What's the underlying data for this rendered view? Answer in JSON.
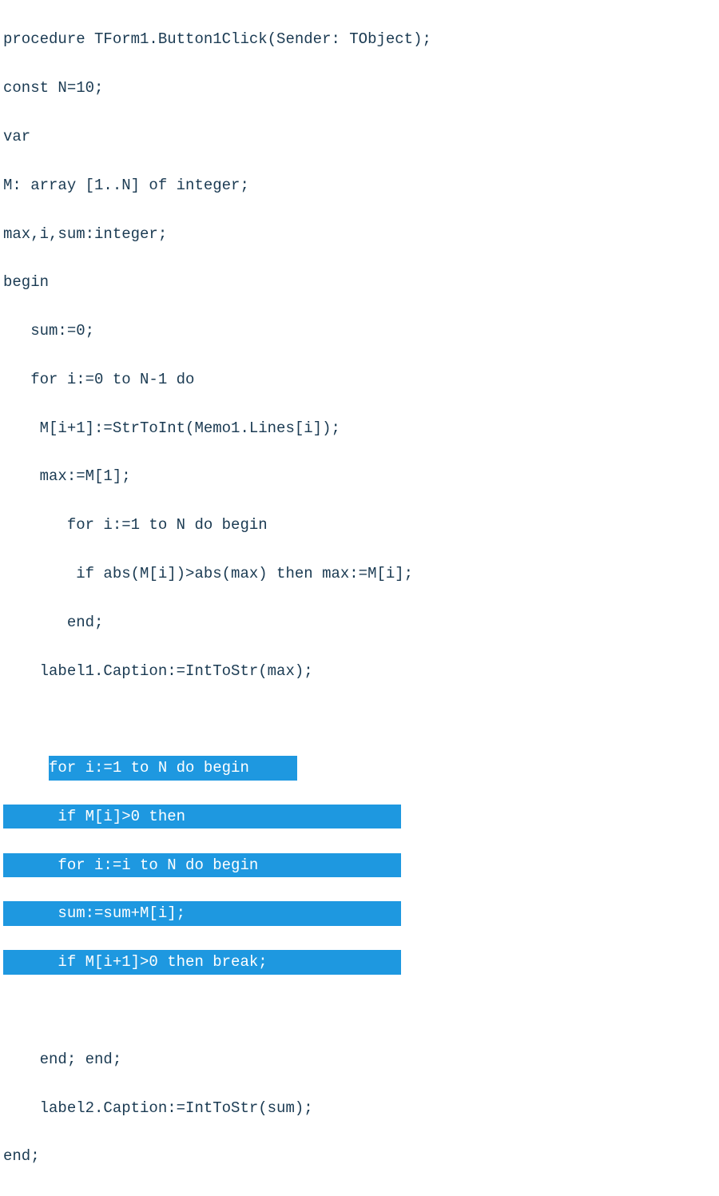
{
  "code": {
    "l1": "procedure TForm1.Button1Click(Sender: TObject);",
    "l2": "const N=10;",
    "l3": "var",
    "l4": "M: array [1..N] of integer;",
    "l5": "max,i,sum:integer;",
    "l6": "begin",
    "l7": "   sum:=0;",
    "l8": "   for i:=0 to N-1 do",
    "l9": "    M[i+1]:=StrToInt(Memo1.Lines[i]);",
    "l10": "    max:=M[1];",
    "l11": "       for i:=1 to N do begin",
    "l12": "        if abs(M[i])>abs(max) then max:=M[i];",
    "l13": "       end;",
    "l14": "    label1.Caption:=IntToStr(max);",
    "l15": "",
    "l16_pad": "     ",
    "l16_sel": "for i:=1 to N do begin",
    "l17": "      if M[i]>0 then",
    "l18": "      for i:=i to N do begin",
    "l19": "      sum:=sum+M[i];",
    "l20": "      if M[i+1]>0 then break;",
    "l21": "",
    "l22": "    end; end;",
    "l23": "    label2.Caption:=IntToStr(sum);",
    "l24": "end;"
  }
}
